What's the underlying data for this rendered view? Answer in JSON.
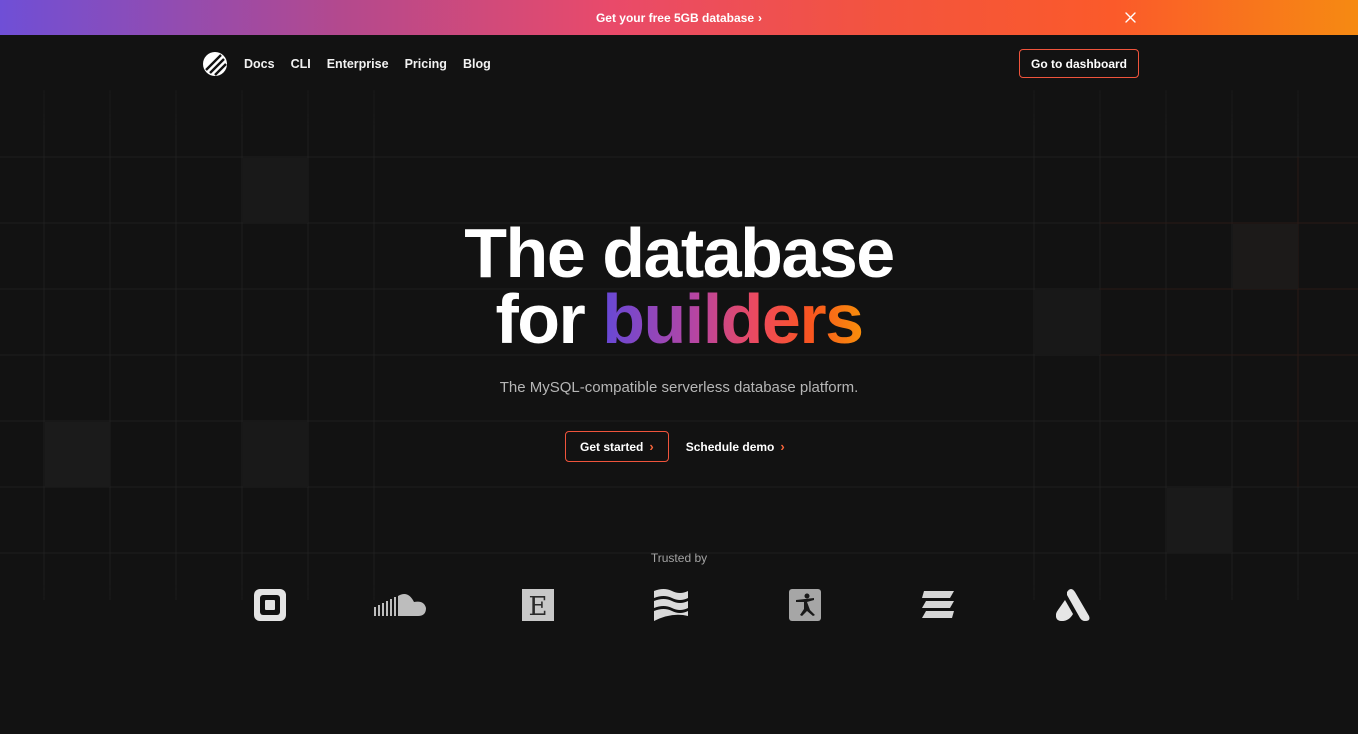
{
  "banner": {
    "text": "Get your free 5GB database",
    "chevron": "›",
    "close_icon": "close-icon",
    "gradient": [
      "#6f4fd6",
      "#e94a6a",
      "#fb5a2a",
      "#f68a12"
    ]
  },
  "nav": {
    "logo_icon": "planetscale-logo-icon",
    "links": [
      "Docs",
      "CLI",
      "Enterprise",
      "Pricing",
      "Blog"
    ],
    "dashboard_label": "Go to dashboard"
  },
  "hero": {
    "title_line1": "The database",
    "title_line2_plain": "for ",
    "title_line2_accent": "builders",
    "subtitle": "The MySQL-compatible serverless database platform.",
    "primary_cta": "Get started",
    "secondary_cta": "Schedule demo",
    "chevron": "›"
  },
  "trusted": {
    "label": "Trusted by",
    "logos": [
      "square-logo-icon",
      "soundcloud-logo-icon",
      "etsy-logo-icon",
      "wave-logo-icon",
      "myfitnesspal-logo-icon",
      "stripes-logo-icon",
      "triangle-a-logo-icon"
    ]
  },
  "colors": {
    "background": "#121212",
    "accent_border": "#f0543c",
    "chevron": "#f5643a",
    "muted_text": "#b6b6b6"
  }
}
